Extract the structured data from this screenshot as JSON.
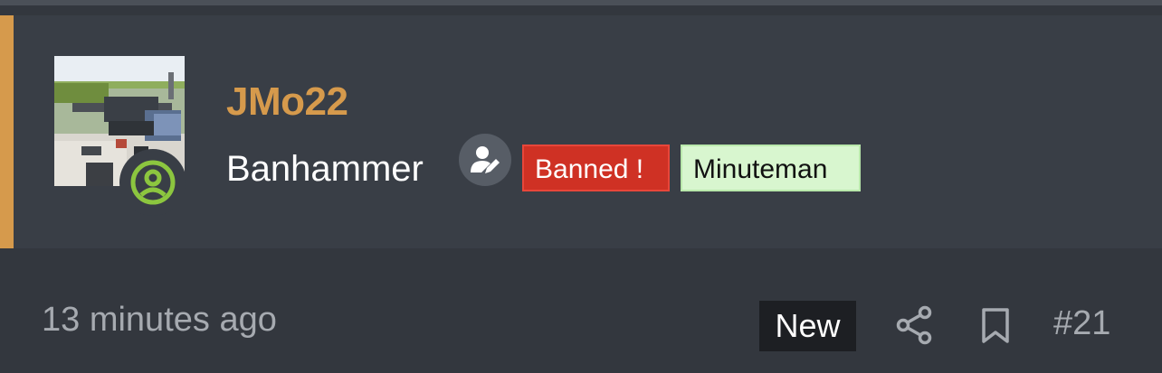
{
  "post": {
    "author": {
      "username": "JMo22",
      "title": "Banhammer",
      "avatar_icon": "avatar-photo",
      "online_icon": "online-user-icon",
      "staff_icon": "staff-edit-icon"
    },
    "banners": [
      {
        "label": "Banned !",
        "bg": "#cf3124",
        "text_color": "#ffffff"
      },
      {
        "label": "Minuteman",
        "bg": "#d8f6cf",
        "text_color": "#111111"
      }
    ],
    "meta": {
      "time": "13 minutes ago",
      "new_label": "New",
      "share_icon": "share-icon",
      "bookmark_icon": "bookmark-icon",
      "post_number": "#21"
    },
    "colors": {
      "accent": "#d69a4c",
      "online": "#8cc63f",
      "background": "#33373e",
      "header_background": "#393e46"
    }
  }
}
